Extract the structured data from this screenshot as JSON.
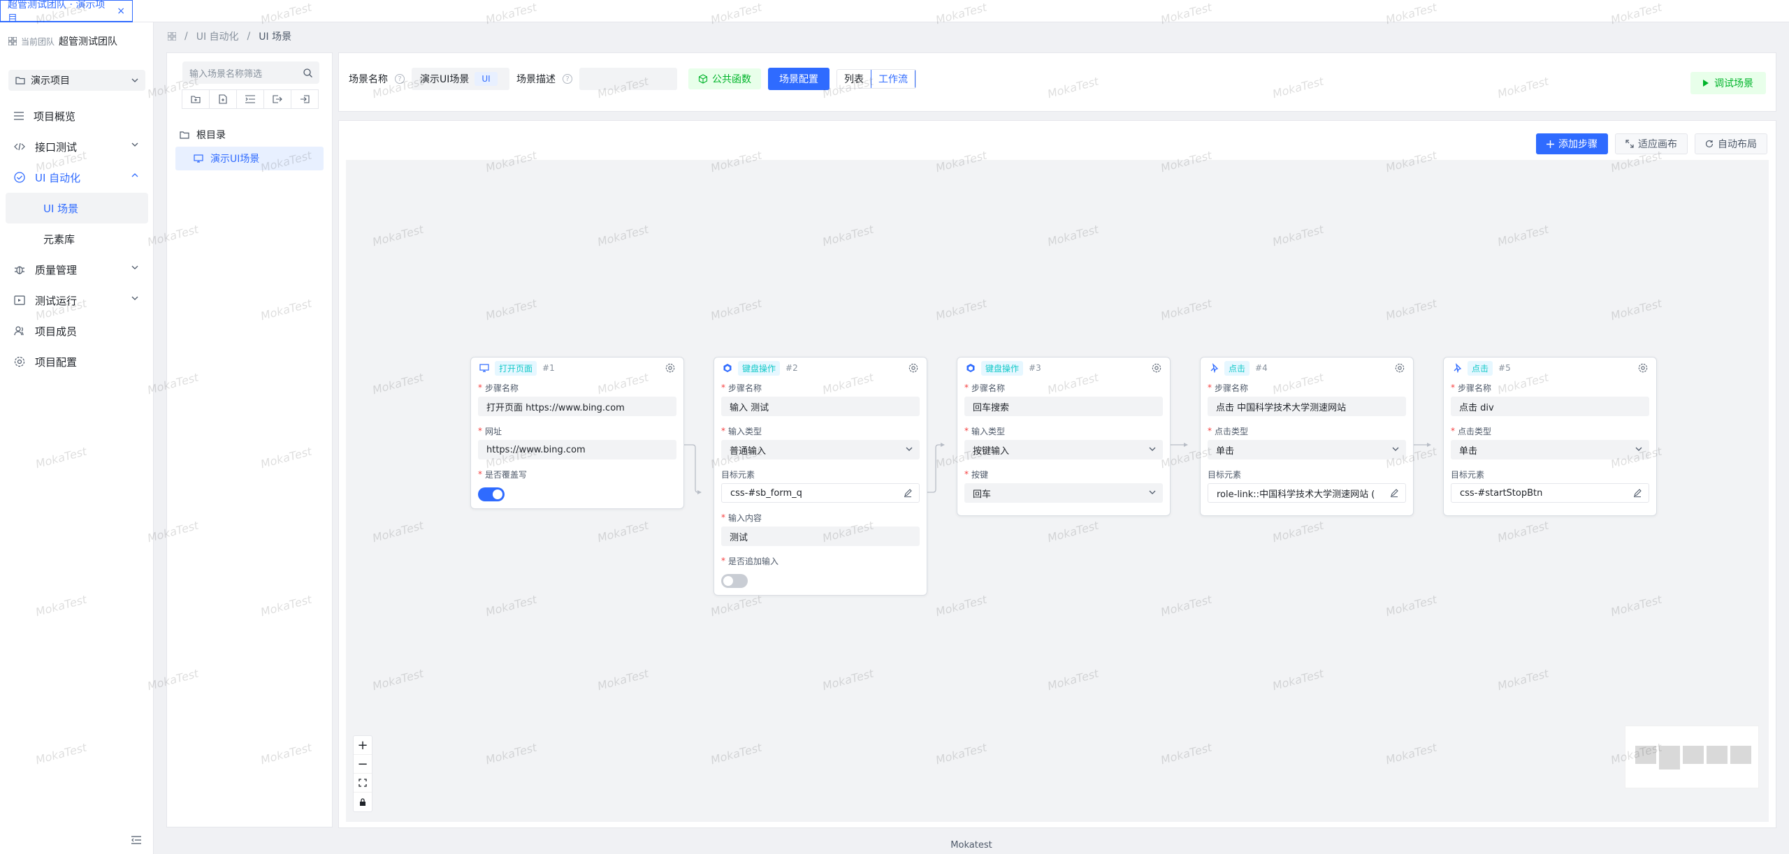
{
  "tab": {
    "label": "超管测试团队 · 演示项目",
    "close": "×"
  },
  "sidebar": {
    "team_label": "当前团队",
    "team_name": "超管测试团队",
    "project": "演示项目",
    "items": [
      {
        "label": "项目概览",
        "icon": "list-icon"
      },
      {
        "label": "接口测试",
        "icon": "code-icon"
      },
      {
        "label": "UI 自动化",
        "icon": "check-circle-icon"
      },
      {
        "label": "质量管理",
        "icon": "bug-icon"
      },
      {
        "label": "测试运行",
        "icon": "run-icon"
      },
      {
        "label": "项目成员",
        "icon": "members-icon"
      },
      {
        "label": "项目配置",
        "icon": "gear-icon"
      }
    ],
    "sub_items": [
      "UI 场景",
      "元素库"
    ]
  },
  "breadcrumb": {
    "level1": "UI 自动化",
    "level2": "UI 场景"
  },
  "tree": {
    "search_placeholder": "输入场景名称筛选",
    "root": "根目录",
    "child": "演示UI场景"
  },
  "config": {
    "name_label": "场景名称",
    "name_value": "演示UI场景",
    "ui_tag": "UI",
    "desc_label": "场景描述",
    "desc_value": "",
    "public_func": "公共函数",
    "scene_config": "场景配置",
    "view_list": "列表",
    "view_flow": "工作流",
    "debug": "调试场景"
  },
  "canvas": {
    "add_step": "添加步骤",
    "fit": "适应画布",
    "auto_layout": "自动布局",
    "zoom_in": "+",
    "zoom_out": "−"
  },
  "nodes": [
    {
      "tag": "打开页面",
      "num": "#1",
      "f1_label": "步骤名称",
      "f1_value": "打开页面 https://www.bing.com",
      "f2_label": "网址",
      "f2_value": "https://www.bing.com",
      "f3_label": "是否覆盖写"
    },
    {
      "tag": "键盘操作",
      "num": "#2",
      "f1_label": "步骤名称",
      "f1_value": "输入 测试",
      "f2_label": "输入类型",
      "f2_value": "普通输入",
      "f3_label": "目标元素",
      "f3_value": "css-#sb_form_q",
      "f4_label": "输入内容",
      "f4_value": "测试",
      "f5_label": "是否追加输入"
    },
    {
      "tag": "键盘操作",
      "num": "#3",
      "f1_label": "步骤名称",
      "f1_value": "回车搜索",
      "f2_label": "输入类型",
      "f2_value": "按键输入",
      "f3_label": "按键",
      "f3_value": "回车"
    },
    {
      "tag": "点击",
      "num": "#4",
      "f1_label": "步骤名称",
      "f1_value": "点击 中国科学技术大学测速网站",
      "f2_label": "点击类型",
      "f2_value": "单击",
      "f3_label": "目标元素",
      "f3_value": "role-link::中国科学技术大学测速网站 ("
    },
    {
      "tag": "点击",
      "num": "#5",
      "f1_label": "步骤名称",
      "f1_value": "点击 div",
      "f2_label": "点击类型",
      "f2_value": "单击",
      "f3_label": "目标元素",
      "f3_value": "css-#startStopBtn"
    }
  ],
  "footer": "Mokatest",
  "watermark": "MokaTest",
  "colors": {
    "accent": "#2f6bff",
    "success": "#00b42a",
    "tag": "#14c9c9"
  }
}
